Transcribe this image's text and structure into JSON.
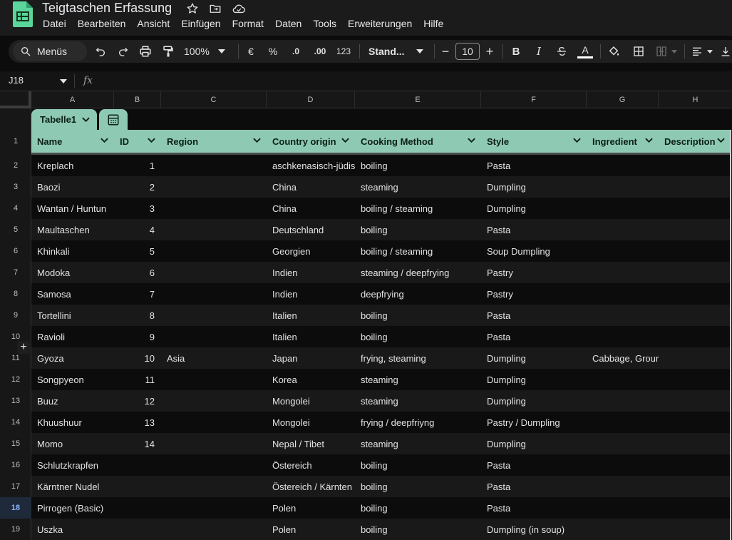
{
  "app": {
    "doc_title": "Teigtaschen Erfassung",
    "icons": [
      "star-icon",
      "move-to-folder-icon",
      "cloud-saved-icon"
    ]
  },
  "menu": [
    "Datei",
    "Bearbeiten",
    "Ansicht",
    "Einfügen",
    "Format",
    "Daten",
    "Tools",
    "Erweiterungen",
    "Hilfe"
  ],
  "toolbar": {
    "search_label": "Menüs",
    "zoom": "100%",
    "currency": "€",
    "percent": "%",
    "decrease_decimals": ".0",
    "increase_decimals": ".00",
    "number_format": "123",
    "font": "Stand...",
    "font_size": "10",
    "minus": "−",
    "plus": "+",
    "bold": "B",
    "italic": "I",
    "text_color": "A"
  },
  "formula_bar": {
    "cell_ref": "J18",
    "fx": "fx"
  },
  "columns": [
    "A",
    "B",
    "C",
    "D",
    "E",
    "F",
    "G",
    "H"
  ],
  "table": {
    "name": "Tabelle1",
    "headers": [
      "Name",
      "ID",
      "Region",
      "Country origin",
      "Cooking Method",
      "Style",
      "Ingredient",
      "Description"
    ],
    "header_color": "#8ec9b3"
  },
  "row_numbers": [
    "1",
    "2",
    "3",
    "4",
    "5",
    "6",
    "7",
    "8",
    "9",
    "10",
    "11",
    "12",
    "13",
    "14",
    "15",
    "16",
    "17",
    "18",
    "19"
  ],
  "selected_row": "18",
  "rows": [
    [
      "Kreplach",
      "1",
      "",
      "aschkenasisch-jüdis",
      "boiling",
      "Pasta",
      "",
      ""
    ],
    [
      "Baozi",
      "2",
      "",
      "China",
      "steaming",
      "Dumpling",
      "",
      ""
    ],
    [
      "Wantan / Huntun",
      "3",
      "",
      "China",
      "boiling / steaming",
      "Dumpling",
      "",
      ""
    ],
    [
      "Maultaschen",
      "4",
      "",
      "Deutschland",
      "boiling",
      "Pasta",
      "",
      ""
    ],
    [
      "Khinkali",
      "5",
      "",
      "Georgien",
      "boiling / steaming",
      "Soup Dumpling",
      "",
      ""
    ],
    [
      "Modoka",
      "6",
      "",
      "Indien",
      "steaming / deepfrying",
      "Pastry",
      "",
      ""
    ],
    [
      "Samosa",
      "7",
      "",
      "Indien",
      "deepfrying",
      "Pastry",
      "",
      ""
    ],
    [
      "Tortellini",
      "8",
      "",
      "Italien",
      "boiling",
      "Pasta",
      "",
      ""
    ],
    [
      "Ravioli",
      "9",
      "",
      "Italien",
      "boiling",
      "Pasta",
      "",
      ""
    ],
    [
      "Gyoza",
      "10",
      "Asia",
      "Japan",
      "frying, steaming",
      "Dumpling",
      "Cabbage, Grour",
      ""
    ],
    [
      "Songpyeon",
      "11",
      "",
      "Korea",
      "steaming",
      "Dumpling",
      "",
      ""
    ],
    [
      "Buuz",
      "12",
      "",
      "Mongolei",
      "steaming",
      "Dumpling",
      "",
      ""
    ],
    [
      "Khuushuur",
      "13",
      "",
      "Mongolei",
      "frying / deepfriyng",
      "Pastry / Dumpling",
      "",
      ""
    ],
    [
      "Momo",
      "14",
      "",
      "Nepal / Tibet",
      "steaming",
      "Dumpling",
      "",
      ""
    ],
    [
      "Schlutzkrapfen",
      "",
      "",
      "Östereich",
      "boiling",
      "Pasta",
      "",
      ""
    ],
    [
      "Kärntner Nudel",
      "",
      "",
      "Östereich / Kärnten",
      "boiling",
      "Pasta",
      "",
      ""
    ],
    [
      "Pirrogen (Basic)",
      "",
      "",
      "Polen",
      "boiling",
      "Pasta",
      "",
      ""
    ],
    [
      "Uszka",
      "",
      "",
      "Polen",
      "boiling",
      "Dumpling (in soup)",
      "",
      ""
    ]
  ]
}
